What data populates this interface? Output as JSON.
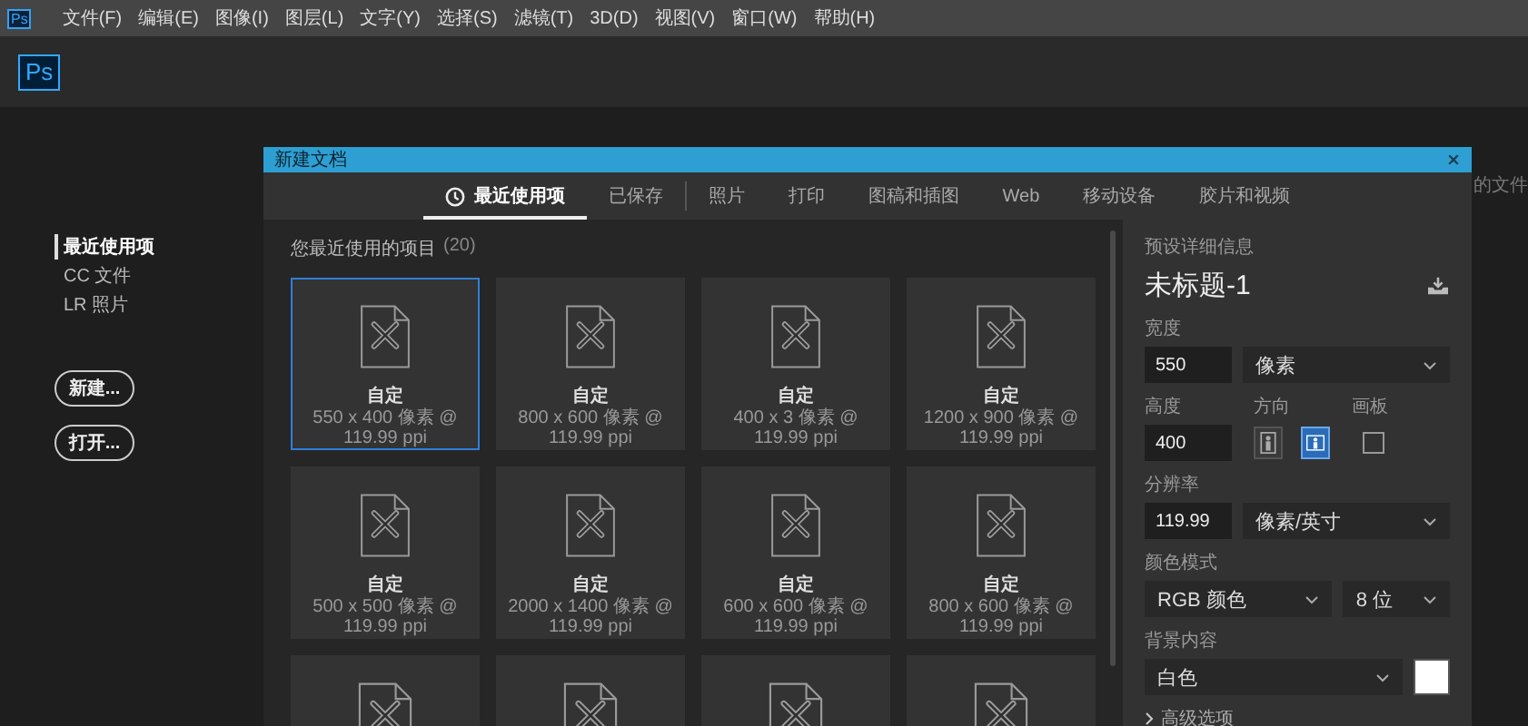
{
  "menu_bar": {
    "items": [
      "文件(F)",
      "编辑(E)",
      "图像(I)",
      "图层(L)",
      "文字(Y)",
      "选择(S)",
      "滤镜(T)",
      "3D(D)",
      "视图(V)",
      "窗口(W)",
      "帮助(H)"
    ]
  },
  "logo": "Ps",
  "app_icon": "Ps",
  "sidebar": {
    "items": [
      {
        "label": "最近使用项",
        "selected": true
      },
      {
        "label": "CC 文件",
        "selected": false
      },
      {
        "label": "LR 照片",
        "selected": false
      }
    ],
    "buttons": [
      "新建...",
      "打开..."
    ]
  },
  "background_text": "的文件",
  "dialog": {
    "title": "新建文档",
    "tabs": [
      {
        "label": "最近使用项",
        "selected": true,
        "kind": "recent"
      },
      {
        "label": "已保存",
        "selected": false,
        "kind": "plain"
      },
      {
        "label": "照片",
        "selected": false,
        "kind": "plain"
      },
      {
        "label": "打印",
        "selected": false,
        "kind": "plain"
      },
      {
        "label": "图稿和插图",
        "selected": false,
        "kind": "plain"
      },
      {
        "label": "Web",
        "selected": false,
        "kind": "plain"
      },
      {
        "label": "移动设备",
        "selected": false,
        "kind": "plain"
      },
      {
        "label": "胶片和视频",
        "selected": false,
        "kind": "plain"
      }
    ],
    "recent": {
      "heading": "您最近使用的项目",
      "count": "(20)",
      "cards": [
        {
          "title": "自定",
          "subtitle": "550 x 400 像素 @ 119.99 ppi",
          "selected": true
        },
        {
          "title": "自定",
          "subtitle": "800 x 600 像素 @ 119.99 ppi",
          "selected": false
        },
        {
          "title": "自定",
          "subtitle": "400 x 3 像素 @ 119.99 ppi",
          "selected": false
        },
        {
          "title": "自定",
          "subtitle": "1200 x 900 像素 @ 119.99 ppi",
          "selected": false
        },
        {
          "title": "自定",
          "subtitle": "500 x 500 像素 @ 119.99 ppi",
          "selected": false
        },
        {
          "title": "自定",
          "subtitle": "2000 x 1400 像素 @ 119.99 ppi",
          "selected": false
        },
        {
          "title": "自定",
          "subtitle": "600 x 600 像素 @ 119.99 ppi",
          "selected": false
        },
        {
          "title": "自定",
          "subtitle": "800 x 600 像素 @ 119.99 ppi",
          "selected": false
        },
        {
          "selected": false
        },
        {
          "selected": false
        },
        {
          "selected": false
        },
        {
          "selected": false
        }
      ]
    },
    "details": {
      "heading": "预设详细信息",
      "name": "未标题-1",
      "width": {
        "label": "宽度",
        "value": "550",
        "unit": "像素"
      },
      "height": {
        "label": "高度",
        "value": "400"
      },
      "orientation": {
        "label": "方向",
        "options": [
          {
            "kind": "portrait",
            "selected": false
          },
          {
            "kind": "landscape",
            "selected": true
          }
        ]
      },
      "artboard": {
        "label": "画板",
        "checked": false
      },
      "resolution": {
        "label": "分辨率",
        "value": "119.99",
        "unit": "像素/英寸"
      },
      "color_mode": {
        "label": "颜色模式",
        "mode": "RGB 颜色",
        "depth": "8 位"
      },
      "background": {
        "label": "背景内容",
        "value": "白色",
        "color": "#ffffff"
      },
      "advanced": {
        "label": "高级选项",
        "expanded": false
      }
    }
  }
}
